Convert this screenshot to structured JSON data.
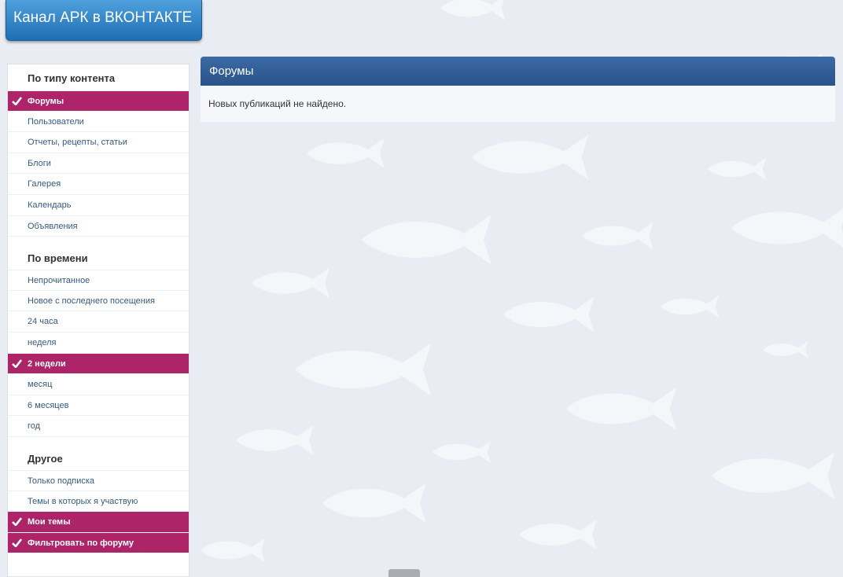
{
  "banner": {
    "label": "Канал АРК в ВКОНТАКТЕ"
  },
  "sidebar": {
    "sections": [
      {
        "title": "По типу контента",
        "items": [
          {
            "label": "Форумы",
            "active": true
          },
          {
            "label": "Пользователи",
            "active": false
          },
          {
            "label": "Отчеты, рецепты, статьи",
            "active": false
          },
          {
            "label": "Блоги",
            "active": false
          },
          {
            "label": "Галерея",
            "active": false
          },
          {
            "label": "Календарь",
            "active": false
          },
          {
            "label": "Объявления",
            "active": false
          }
        ]
      },
      {
        "title": "По времени",
        "items": [
          {
            "label": "Непрочитанное",
            "active": false
          },
          {
            "label": "Новое с последнего посещения",
            "active": false
          },
          {
            "label": "24 часа",
            "active": false
          },
          {
            "label": "неделя",
            "active": false
          },
          {
            "label": "2 недели",
            "active": true
          },
          {
            "label": "месяц",
            "active": false
          },
          {
            "label": "6 месяцев",
            "active": false
          },
          {
            "label": "год",
            "active": false
          }
        ]
      },
      {
        "title": "Другое",
        "items": [
          {
            "label": "Только подписка",
            "active": false
          },
          {
            "label": "Темы в которых я участвую",
            "active": false
          },
          {
            "label": "Мои темы",
            "active": true
          },
          {
            "label": "Фильтровать по форуму",
            "active": true
          }
        ]
      }
    ]
  },
  "main": {
    "header": "Форумы",
    "message": "Новых публикаций не найдено."
  },
  "colors": {
    "accent": "#ad2469",
    "header": "#335e96",
    "banner": "#2a80c6",
    "background": "#e9edf3"
  },
  "icons": {
    "check": "check-icon"
  }
}
